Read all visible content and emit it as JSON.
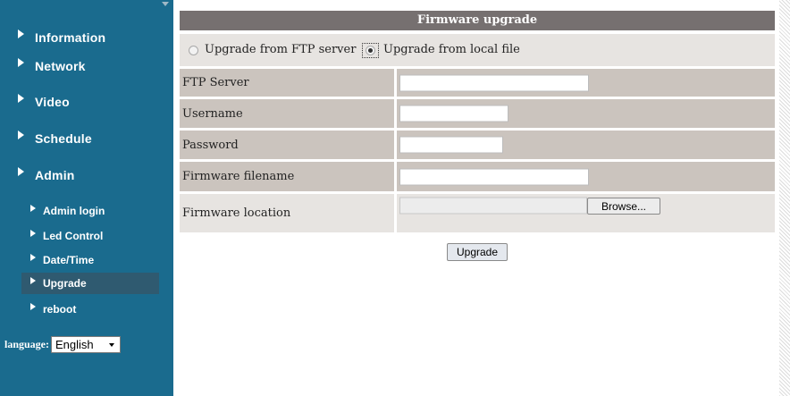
{
  "sidebar": {
    "main_items": [
      {
        "label": "Information"
      },
      {
        "label": "Network"
      },
      {
        "label": "Video"
      },
      {
        "label": "Schedule"
      },
      {
        "label": "Admin"
      }
    ],
    "sub_items": [
      {
        "label": "Admin login"
      },
      {
        "label": "Led Control"
      },
      {
        "label": "Date/Time"
      },
      {
        "label": "Upgrade",
        "active": true
      },
      {
        "label": "reboot"
      }
    ],
    "language": {
      "label": "language:",
      "selected": "English"
    }
  },
  "main": {
    "title": "Firmware upgrade",
    "source": {
      "ftp_label": "Upgrade from FTP server",
      "local_label": "Upgrade from local file",
      "selected": "local"
    },
    "fields": {
      "ftp_server": {
        "label": "FTP Server",
        "value": ""
      },
      "username": {
        "label": "Username",
        "value": ""
      },
      "password": {
        "label": "Password",
        "value": ""
      },
      "firmware_filename": {
        "label": "Firmware filename",
        "value": ""
      },
      "firmware_location": {
        "label": "Firmware location",
        "value": "",
        "browse_label": "Browse..."
      }
    },
    "upgrade_button": "Upgrade"
  },
  "colors": {
    "sidebar_bg": "#1a6b8e",
    "active_item_bg": "#2f5a70",
    "header_bg": "#767070",
    "row_dark": "#cbc4be",
    "row_light": "#e7e4e1"
  }
}
